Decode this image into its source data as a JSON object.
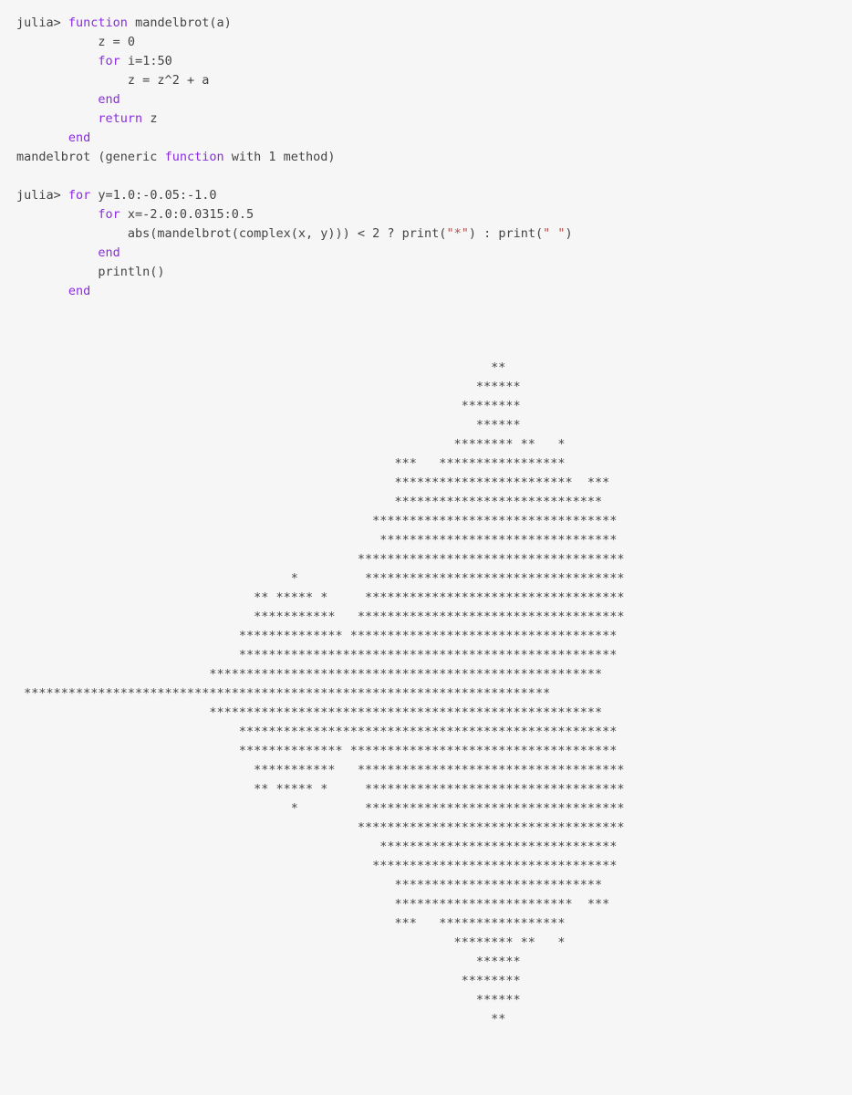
{
  "repl": {
    "block1": {
      "prompt": "julia> ",
      "l1_kw": "function",
      "l1_rest": " mandelbrot(a)",
      "l2": "           z = ",
      "l2_num": "0",
      "l3_indent": "           ",
      "l3_kw": "for",
      "l3_rest": " i=",
      "l3_num1": "1",
      "l3_colon": ":",
      "l3_num2": "50",
      "l4": "               z = z^",
      "l4_num": "2",
      "l4_rest": " + a",
      "l5_indent": "           ",
      "l5_kw": "end",
      "l6_indent": "           ",
      "l6_kw": "return",
      "l6_rest": " z",
      "l7_indent": "       ",
      "l7_kw": "end",
      "out_a": "mandelbrot (generic ",
      "out_kw": "function",
      "out_b": " with ",
      "out_num": "1",
      "out_c": " method)"
    },
    "block2": {
      "prompt": "julia> ",
      "l1_kw": "for",
      "l1_rest": " y=",
      "l1_num1": "1.0",
      "l1_c1": ":-",
      "l1_num2": "0.05",
      "l1_c2": ":-",
      "l1_num3": "1.0",
      "l2_indent": "           ",
      "l2_kw": "for",
      "l2_rest": " x=-",
      "l2_num1": "2.0",
      "l2_c1": ":",
      "l2_num2": "0.0315",
      "l2_c2": ":",
      "l2_num3": "0.5",
      "l3_a": "               abs(mandelbrot(complex(x, y))) < ",
      "l3_num": "2",
      "l3_b": " ? print(",
      "l3_s1": "\"*\"",
      "l3_c": ") : print(",
      "l3_s2": "\" \"",
      "l3_d": ")",
      "l4_indent": "           ",
      "l4_kw": "end",
      "l5": "           println()",
      "l6_indent": "       ",
      "l6_kw": "end"
    },
    "output_lines": [
      "",
      "                                                                                ",
      "                                                                                ",
      "                                                                **              ",
      "                                                              ******            ",
      "                                                            ********            ",
      "                                                              ******            ",
      "                                                           ******** **   *      ",
      "                                                   ***   *****************      ",
      "                                                   ************************  ***",
      "                                                   ****************************  ",
      "                                                *********************************",
      "                                                 ********************************",
      "                                              ************************************  ",
      "                                     *         *********************************** ",
      "                                ** ***** *     ***********************************  ",
      "                                ***********   ************************************  ",
      "                              ************** ************************************   ",
      "                              ***************************************************   ",
      "                          *****************************************************    ",
      " ***********************************************************************       ",
      "                          *****************************************************    ",
      "                              ***************************************************   ",
      "                              ************** ************************************   ",
      "                                ***********   ************************************  ",
      "                                ** ***** *     ***********************************  ",
      "                                     *         *********************************** ",
      "                                              ************************************  ",
      "                                                 ********************************",
      "                                                *********************************",
      "                                                   ****************************  ",
      "                                                   ************************  ***",
      "                                                   ***   *****************      ",
      "                                                           ******** **   *      ",
      "                                                              ******            ",
      "                                                            ********            ",
      "                                                              ******            ",
      "                                                                **              ",
      "                                                                                ",
      "                                                                                "
    ]
  }
}
